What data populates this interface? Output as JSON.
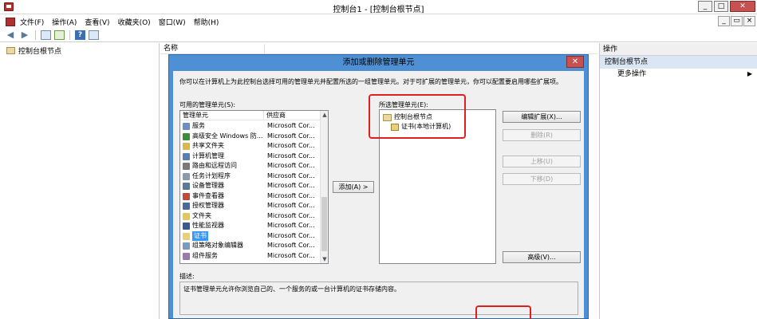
{
  "window": {
    "title": "控制台1 - [控制台根节点]",
    "controls": [
      "_",
      "□",
      "✕"
    ]
  },
  "menubar": {
    "items": [
      "文件(F)",
      "操作(A)",
      "查看(V)",
      "收藏夹(O)",
      "窗口(W)",
      "帮助(H)"
    ],
    "inner_controls": [
      "_",
      "▭",
      "×"
    ]
  },
  "toolbar": {
    "icons": [
      "back-icon",
      "forward-icon",
      "show-hide-tree-icon",
      "export-list-icon",
      "help-icon",
      "properties-icon"
    ]
  },
  "tree": {
    "root_label": "控制台根节点"
  },
  "center": {
    "column_header": "名称"
  },
  "actions": {
    "pane_title": "操作",
    "section": "控制台根节点",
    "more_actions": "更多操作"
  },
  "dialog": {
    "title": "添加或删除管理单元",
    "close": "✕",
    "intro": "你可以在计算机上为此控制台选择可用的管理单元并配置所选的一组管理单元。对于可扩展的管理单元，你可以配置要启用哪些扩展项。",
    "available_label": "可用的管理单元(S):",
    "available_headers": [
      "管理单元",
      "供应商"
    ],
    "available": [
      {
        "name": "服务",
        "vendor": "Microsoft Cor...",
        "icon": "#6a8fc2"
      },
      {
        "name": "高级安全 Windows 防...",
        "vendor": "Microsoft Cor...",
        "icon": "#3c8d3c"
      },
      {
        "name": "共享文件夹",
        "vendor": "Microsoft Cor...",
        "icon": "#d8b84a"
      },
      {
        "name": "计算机管理",
        "vendor": "Microsoft Cor...",
        "icon": "#5a7fb0"
      },
      {
        "name": "路由和远程访问",
        "vendor": "Microsoft Cor...",
        "icon": "#7a7a7a"
      },
      {
        "name": "任务计划程序",
        "vendor": "Microsoft Cor...",
        "icon": "#8a9ab0"
      },
      {
        "name": "设备管理器",
        "vendor": "Microsoft Cor...",
        "icon": "#5a7a9a"
      },
      {
        "name": "事件查看器",
        "vendor": "Microsoft Cor...",
        "icon": "#c24a3a"
      },
      {
        "name": "授权管理器",
        "vendor": "Microsoft Cor...",
        "icon": "#4a6a9a"
      },
      {
        "name": "文件夹",
        "vendor": "Microsoft Cor...",
        "icon": "#e1c65a"
      },
      {
        "name": "性能监视器",
        "vendor": "Microsoft Cor...",
        "icon": "#3a5a8a"
      },
      {
        "name": "证书",
        "vendor": "Microsoft Cor...",
        "icon": "#e9cf7a",
        "selected": true
      },
      {
        "name": "组策略对象编辑器",
        "vendor": "Microsoft Cor...",
        "icon": "#7a9ac2"
      },
      {
        "name": "组件服务",
        "vendor": "Microsoft Cor...",
        "icon": "#9a7ab0"
      }
    ],
    "add_button": "添加(A) >",
    "selected_label": "所选管理单元(E):",
    "selected_root": "控制台根节点",
    "selected_child": "证书(本地计算机)",
    "buttons": {
      "edit_ext": "编辑扩展(X)...",
      "remove": "删除(R)",
      "move_up": "上移(U)",
      "move_down": "下移(D)",
      "advanced": "高级(V)..."
    },
    "desc_label": "描述:",
    "description": "证书管理单元允许你浏览自己的、一个服务的或一台计算机的证书存储内容。"
  },
  "colors": {
    "dialog_frame": "#4f90d4",
    "highlight": "#e02020",
    "selection": "#3399ff"
  }
}
